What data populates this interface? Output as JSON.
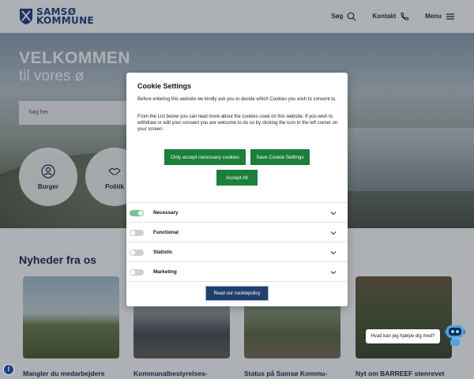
{
  "header": {
    "logo_line1": "SAMSØ",
    "logo_line2": "KOMMUNE",
    "nav": [
      {
        "label": "Søg",
        "icon": "search-icon"
      },
      {
        "label": "Kontakt",
        "icon": "phone-icon"
      },
      {
        "label": "Menu",
        "icon": "hamburger-icon"
      }
    ]
  },
  "hero": {
    "title": "VELKOMMEN",
    "subtitle": "til vores ø",
    "search_placeholder": "Søg her",
    "circles": [
      {
        "label": "Borger",
        "icon": "person-icon"
      },
      {
        "label": "Politik",
        "icon": "handshake-icon"
      }
    ]
  },
  "news": {
    "heading": "Nyheder fra os",
    "cards": [
      {
        "title": "Mangler du medarbejdere"
      },
      {
        "title": "Kommunalbestyrelses-"
      },
      {
        "title": "Status på Samsø Kommu-"
      },
      {
        "title": "Nyt om BARREEF stenrevet"
      }
    ]
  },
  "cookie_modal": {
    "title": "Cookie Settings",
    "paragraph1": "Before entering this website we kindly ask you to decide which Cookies you wish to consent to.",
    "paragraph2": "From the List below you can read more about the cookies used on this website. If you wish to withdraw or edit your consent you are welcome to do so by clicking the icon in the left corner on your screen.",
    "btn_necessary": "Only accept necessary cookies",
    "btn_save": "Save Cookie Settings",
    "btn_accept_all": "Accept All",
    "categories": [
      {
        "label": "Necessary",
        "enabled": true
      },
      {
        "label": "Functional",
        "enabled": false
      },
      {
        "label": "Statistic",
        "enabled": false
      },
      {
        "label": "Marketing",
        "enabled": false
      }
    ],
    "policy_button": "Read our cookiepolicy"
  },
  "chat": {
    "bubble_text": "Hvad kan jeg hjælpe dig med?"
  },
  "colors": {
    "brand_blue": "#1f3f86",
    "accent_green": "#1a7f3a",
    "policy_button": "#1f3f6e"
  }
}
